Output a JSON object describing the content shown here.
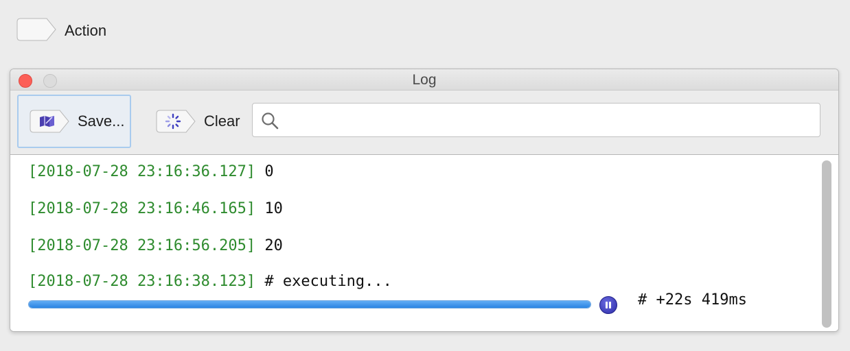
{
  "action": {
    "label": "Action"
  },
  "window": {
    "title": "Log"
  },
  "toolbar": {
    "save_label": "Save...",
    "clear_label": "Clear",
    "search_value": ""
  },
  "log": {
    "lines": [
      {
        "time": "[2018-07-28 23:16:36.127]",
        "message": " 0"
      },
      {
        "time": "[2018-07-28 23:16:46.165]",
        "message": " 10"
      },
      {
        "time": "[2018-07-28 23:16:56.205]",
        "message": " 20"
      },
      {
        "time": "[2018-07-28 23:16:38.123]",
        "message": " # executing..."
      }
    ],
    "progress": {
      "fraction": 1.0,
      "elapsed": "# +22s 419ms"
    }
  },
  "colors": {
    "timestamp": "#2e8b2e",
    "progress": "#2a84e2",
    "close": "#fc5f57"
  },
  "icons": [
    "tag-button-icon",
    "book-icon",
    "spinner-icon",
    "search-icon",
    "pause-icon"
  ]
}
